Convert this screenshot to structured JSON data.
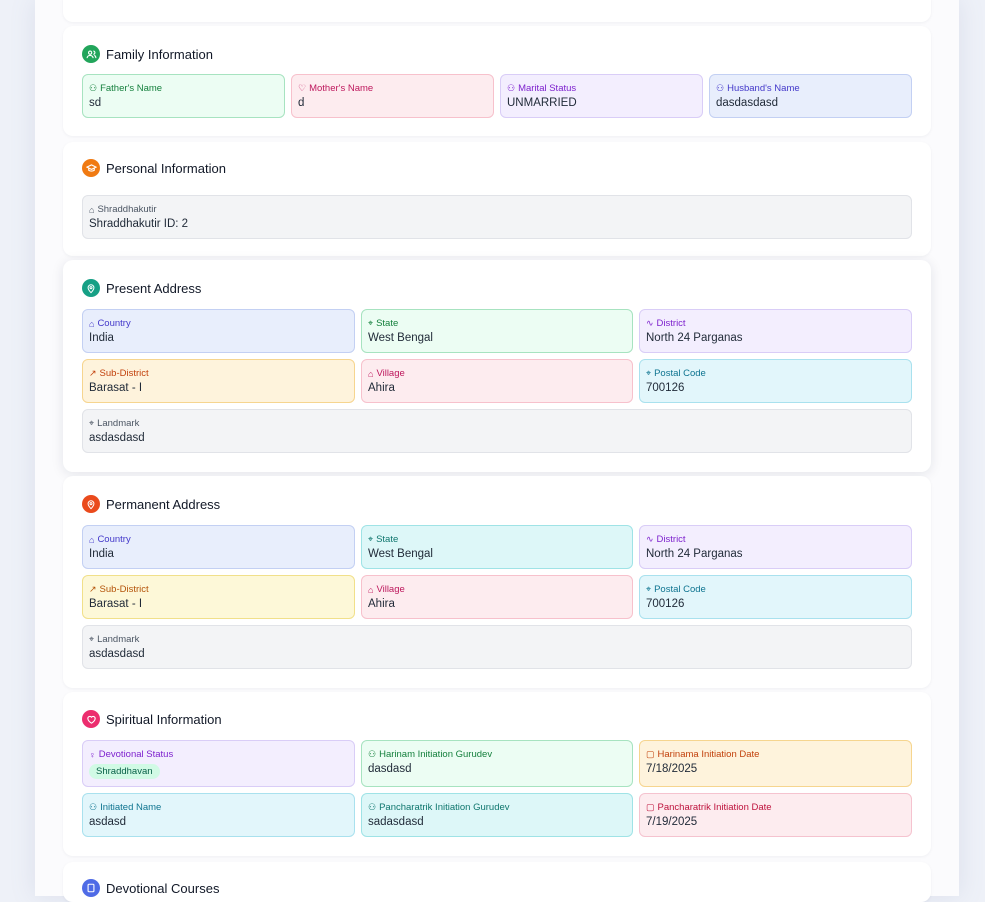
{
  "colors": {
    "family_icon": "#22a55b",
    "personal_icon": "#f07a12",
    "present_icon": "#16a085",
    "permanent_icon": "#ea4a1c",
    "spiritual_icon": "#ec2d6e",
    "courses_icon": "#4f6be6"
  },
  "family": {
    "title": "Family Information",
    "icon": "users-icon",
    "fathers_name": {
      "label": "Father's Name",
      "value": "sd",
      "icon": "user-icon"
    },
    "mothers_name": {
      "label": "Mother's Name",
      "value": "d",
      "icon": "heart-icon"
    },
    "marital_status": {
      "label": "Marital Status",
      "value": "UNMARRIED",
      "icon": "users-icon"
    },
    "husbands_name": {
      "label": "Husband's Name",
      "value": "dasdasdasd",
      "icon": "user-icon"
    }
  },
  "personal": {
    "title": "Personal Information",
    "icon": "graduation-cap-icon",
    "shraddhakutir": {
      "label": "Shraddhakutir",
      "value": "Shraddhakutir ID: 2",
      "icon": "home-icon"
    }
  },
  "present_address": {
    "title": "Present Address",
    "icon": "map-pin-icon",
    "country": {
      "label": "Country",
      "value": "India"
    },
    "state": {
      "label": "State",
      "value": "West Bengal"
    },
    "district": {
      "label": "District",
      "value": "North 24 Parganas"
    },
    "sub_district": {
      "label": "Sub-District",
      "value": "Barasat - I"
    },
    "village": {
      "label": "Village",
      "value": "Ahira"
    },
    "postal_code": {
      "label": "Postal Code",
      "value": "700126"
    },
    "landmark": {
      "label": "Landmark",
      "value": "asdasdasd"
    }
  },
  "permanent_address": {
    "title": "Permanent Address",
    "icon": "map-pin-icon",
    "country": {
      "label": "Country",
      "value": "India"
    },
    "state": {
      "label": "State",
      "value": "West Bengal"
    },
    "district": {
      "label": "District",
      "value": "North 24 Parganas"
    },
    "sub_district": {
      "label": "Sub-District",
      "value": "Barasat - I"
    },
    "village": {
      "label": "Village",
      "value": "Ahira"
    },
    "postal_code": {
      "label": "Postal Code",
      "value": "700126"
    },
    "landmark": {
      "label": "Landmark",
      "value": "asdasdasd"
    }
  },
  "spiritual": {
    "title": "Spiritual Information",
    "icon": "heart-icon",
    "devotional_status": {
      "label": "Devotional Status",
      "value": "Shraddhavan"
    },
    "harinam_gurudev": {
      "label": "Harinam Initiation Gurudev",
      "value": "dasdasd"
    },
    "harinama_date": {
      "label": "Harinama Initiation Date",
      "value": "7/18/2025"
    },
    "initiated_name": {
      "label": "Initiated Name",
      "value": "asdasd"
    },
    "pancharatrik_gurudev": {
      "label": "Pancharatrik Initiation Gurudev",
      "value": "sadasdasd"
    },
    "pancharatrik_date": {
      "label": "Pancharatrik Initiation Date",
      "value": "7/19/2025"
    }
  },
  "courses": {
    "title": "Devotional Courses",
    "icon": "book-icon"
  }
}
